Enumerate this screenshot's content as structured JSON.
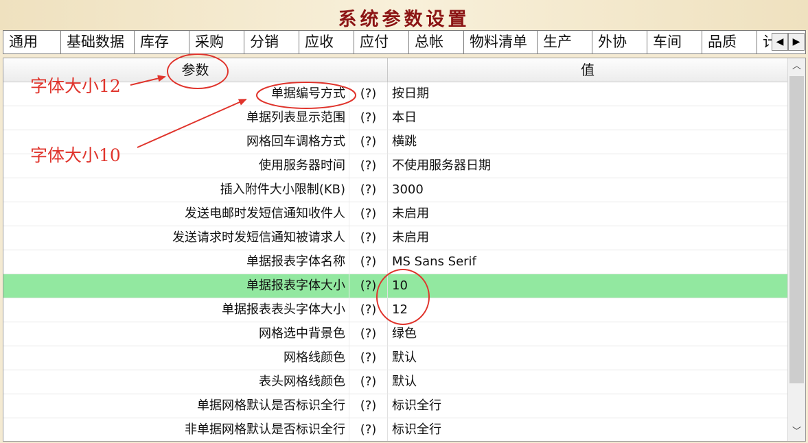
{
  "window": {
    "title": "系统参数设置"
  },
  "tabs": [
    "通用",
    "基础数据",
    "库存",
    "采购",
    "分销",
    "应收",
    "应付",
    "总帐",
    "物料清单",
    "生产",
    "外协",
    "车间",
    "品质",
    "计"
  ],
  "tab_scroll": {
    "left": "◀",
    "right": "▶"
  },
  "grid": {
    "headers": {
      "param": "参数",
      "value": "值"
    },
    "help_label": "(?)",
    "rows": [
      {
        "name": "单据编号方式",
        "value": "按日期"
      },
      {
        "name": "单据列表显示范围",
        "value": "本日"
      },
      {
        "name": "网格回车调格方式",
        "value": "横跳"
      },
      {
        "name": "使用服务器时间",
        "value": "不使用服务器日期"
      },
      {
        "name": "插入附件大小限制(KB)",
        "value": "3000"
      },
      {
        "name": "发送电邮时发短信通知收件人",
        "value": "未启用"
      },
      {
        "name": "发送请求时发短信通知被请求人",
        "value": "未启用"
      },
      {
        "name": "单据报表字体名称",
        "value": "MS Sans Serif"
      },
      {
        "name": "单据报表字体大小",
        "value": "10"
      },
      {
        "name": "单据报表表头字体大小",
        "value": "12"
      },
      {
        "name": "网格选中背景色",
        "value": "绿色"
      },
      {
        "name": "网格线颜色",
        "value": "默认"
      },
      {
        "name": "表头网格线颜色",
        "value": "默认"
      },
      {
        "name": "单据网格默认是否标识全行",
        "value": "标识全行"
      },
      {
        "name": "非单据网格默认是否标识全行",
        "value": "标识全行"
      }
    ],
    "selected_row": 8,
    "selected_color": "#92e8a0"
  },
  "scrollbar": {
    "up": "︿",
    "down": "﹀"
  },
  "annotations": {
    "note1": "字体大小12",
    "note2": "字体大小10",
    "color": "#e0342c"
  }
}
